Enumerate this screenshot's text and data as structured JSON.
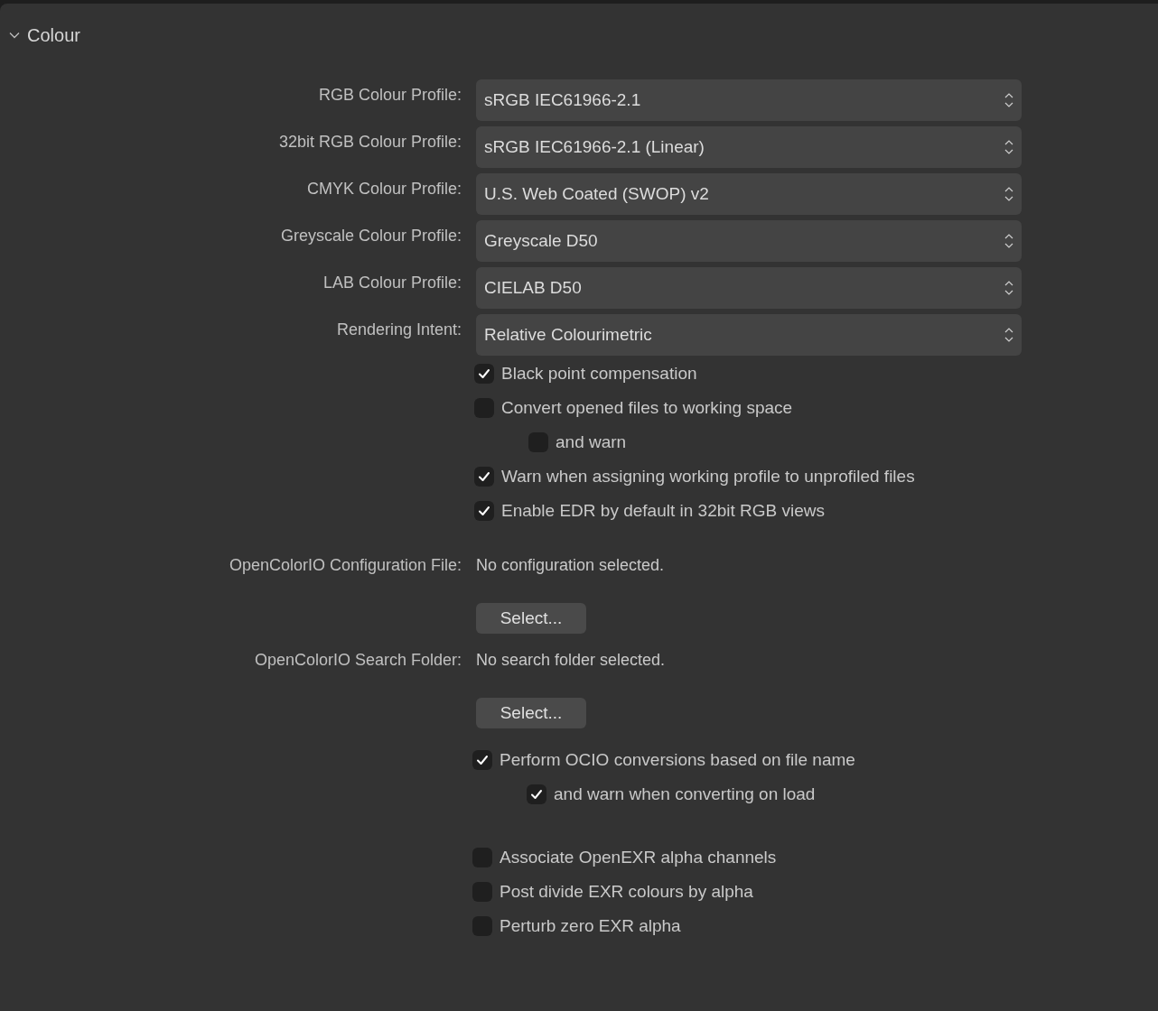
{
  "section": {
    "title": "Colour",
    "expanded": true
  },
  "profiles": [
    {
      "label": "RGB Colour Profile:",
      "value": "sRGB IEC61966-2.1"
    },
    {
      "label": "32bit RGB Colour Profile:",
      "value": "sRGB IEC61966-2.1 (Linear)"
    },
    {
      "label": "CMYK Colour Profile:",
      "value": "U.S. Web Coated (SWOP) v2"
    },
    {
      "label": "Greyscale Colour Profile:",
      "value": "Greyscale D50"
    },
    {
      "label": "LAB Colour Profile:",
      "value": "CIELAB D50"
    },
    {
      "label": "Rendering Intent:",
      "value": "Relative Colourimetric"
    }
  ],
  "options": [
    {
      "label": "Black point compensation",
      "checked": true
    },
    {
      "label": "Convert opened files to working space",
      "checked": false,
      "children": [
        {
          "label": "and warn",
          "checked": false
        }
      ]
    },
    {
      "label": "Warn when assigning working profile to unprofiled files",
      "checked": true
    },
    {
      "label": "Enable EDR by default in 32bit RGB views",
      "checked": true
    }
  ],
  "ocio": [
    {
      "label": "OpenColorIO Configuration File:",
      "value": "No configuration selected.",
      "button": "Select..."
    },
    {
      "label": "OpenColorIO Search Folder:",
      "value": "No search folder selected.",
      "button": "Select..."
    }
  ],
  "ocio_options": [
    {
      "label": "Perform OCIO conversions based on file name",
      "checked": true,
      "children": [
        {
          "label": "and warn when converting on load",
          "checked": true
        }
      ]
    }
  ],
  "exr_options": [
    {
      "label": "Associate OpenEXR alpha channels",
      "checked": false
    },
    {
      "label": "Post divide EXR colours by alpha",
      "checked": false
    },
    {
      "label": "Perturb zero EXR alpha",
      "checked": false
    }
  ]
}
